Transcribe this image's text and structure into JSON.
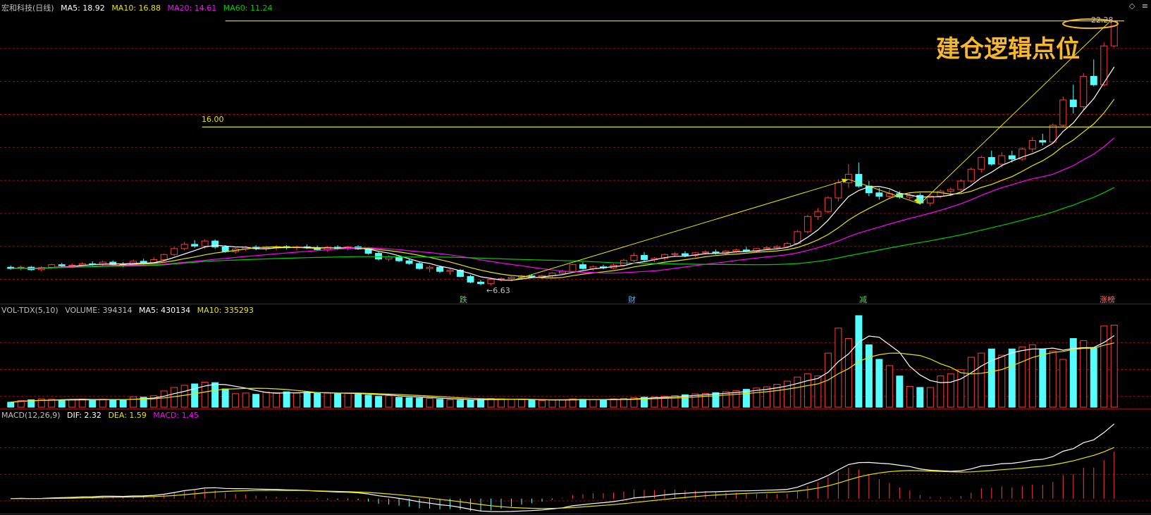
{
  "header": {
    "stock_name": "宏和科技(日线)",
    "ma5": "MA5: 18.92",
    "ma10": "MA10: 16.88",
    "ma20": "MA20: 14.61",
    "ma60": "MA60: 11.24"
  },
  "vol_header": {
    "name": "VOL-TDX(5,10)",
    "volume": "VOLUME: 394314",
    "ma5": "MA5: 430134",
    "ma10": "MA10: 335293"
  },
  "macd_header": {
    "name": "MACD(12,26,9)",
    "dif": "DIF: 2.32",
    "dea": "DEA: 1.59",
    "macd": "MACD: 1.45"
  },
  "icons": {
    "diamond": "◇",
    "menu": "≡"
  },
  "annotations": {
    "big_text": "建仓逻辑点位",
    "level_16": "16.00",
    "high_label": "22.28",
    "low_label": "←6.63",
    "event_1": "跌",
    "event_2": "财",
    "event_3": "减",
    "event_4": "涨榜"
  },
  "colors": {
    "up": "#ff3b3b",
    "down": "#54fcfc",
    "ma5": "#ffffff",
    "ma10": "#e6e600",
    "ma20": "#ff00ff",
    "ma60": "#00cc00",
    "grid": "#8a1010",
    "hline": "#e6e600",
    "annot": "#f3b82e"
  },
  "chart_data": [
    {
      "type": "candlestick",
      "series_hint": "daily candles, price in CNY",
      "ylim": [
        6,
        22.6
      ],
      "ohlc": [
        [
          7.7,
          7.8,
          7.55,
          7.62
        ],
        [
          7.62,
          7.8,
          7.5,
          7.7
        ],
        [
          7.7,
          7.78,
          7.48,
          7.55
        ],
        [
          7.55,
          7.75,
          7.45,
          7.68
        ],
        [
          7.68,
          7.9,
          7.6,
          7.85
        ],
        [
          7.85,
          7.95,
          7.7,
          7.78
        ],
        [
          7.78,
          7.92,
          7.65,
          7.82
        ],
        [
          7.82,
          8.0,
          7.72,
          7.9
        ],
        [
          7.9,
          8.05,
          7.8,
          7.88
        ],
        [
          7.88,
          8.1,
          7.75,
          8.0
        ],
        [
          8.0,
          8.1,
          7.8,
          7.86
        ],
        [
          7.86,
          8.0,
          7.7,
          7.82
        ],
        [
          7.82,
          8.15,
          7.76,
          8.05
        ],
        [
          8.05,
          8.2,
          7.85,
          7.95
        ],
        [
          7.95,
          8.3,
          7.9,
          8.15
        ],
        [
          8.15,
          8.5,
          8.05,
          8.45
        ],
        [
          8.45,
          8.9,
          8.35,
          8.8
        ],
        [
          8.8,
          9.2,
          8.7,
          9.05
        ],
        [
          9.05,
          9.3,
          8.85,
          8.95
        ],
        [
          8.95,
          9.35,
          8.8,
          9.25
        ],
        [
          9.25,
          9.35,
          8.8,
          8.9
        ],
        [
          8.9,
          9.0,
          8.55,
          8.62
        ],
        [
          8.62,
          8.85,
          8.5,
          8.78
        ],
        [
          8.78,
          8.95,
          8.65,
          8.88
        ],
        [
          8.88,
          9.0,
          8.7,
          8.8
        ],
        [
          8.8,
          8.95,
          8.65,
          8.85
        ],
        [
          8.85,
          9.0,
          8.7,
          8.92
        ],
        [
          8.92,
          9.0,
          8.75,
          8.85
        ],
        [
          8.85,
          8.98,
          8.7,
          8.9
        ],
        [
          8.9,
          9.05,
          8.78,
          8.86
        ],
        [
          8.86,
          8.98,
          8.68,
          8.74
        ],
        [
          8.74,
          8.95,
          8.62,
          8.88
        ],
        [
          8.88,
          9.0,
          8.72,
          8.8
        ],
        [
          8.8,
          8.95,
          8.7,
          8.9
        ],
        [
          8.9,
          9.0,
          8.72,
          8.78
        ],
        [
          8.78,
          8.88,
          8.45,
          8.52
        ],
        [
          8.52,
          8.6,
          8.1,
          8.18
        ],
        [
          8.18,
          8.4,
          8.05,
          8.3
        ],
        [
          8.3,
          8.35,
          8.0,
          8.08
        ],
        [
          8.08,
          8.2,
          7.85,
          7.92
        ],
        [
          7.92,
          8.05,
          7.55,
          7.62
        ],
        [
          7.62,
          7.8,
          7.4,
          7.7
        ],
        [
          7.7,
          7.78,
          7.35,
          7.45
        ],
        [
          7.45,
          7.6,
          7.25,
          7.52
        ],
        [
          7.52,
          7.6,
          7.1,
          7.15
        ],
        [
          7.15,
          7.25,
          6.75,
          6.82
        ],
        [
          6.82,
          6.95,
          6.63,
          6.72
        ],
        [
          6.72,
          7.05,
          6.63,
          6.98
        ],
        [
          6.98,
          7.1,
          6.85,
          7.02
        ],
        [
          7.02,
          7.15,
          6.92,
          7.1
        ],
        [
          7.1,
          7.25,
          7.0,
          7.18
        ],
        [
          7.18,
          7.3,
          7.05,
          7.12
        ],
        [
          7.12,
          7.25,
          7.0,
          7.2
        ],
        [
          7.2,
          7.4,
          7.1,
          7.35
        ],
        [
          7.35,
          7.55,
          7.25,
          7.45
        ],
        [
          7.45,
          7.9,
          7.4,
          7.85
        ],
        [
          7.85,
          8.0,
          7.55,
          7.62
        ],
        [
          7.62,
          7.8,
          7.5,
          7.72
        ],
        [
          7.72,
          7.85,
          7.58,
          7.66
        ],
        [
          7.66,
          7.9,
          7.6,
          7.82
        ],
        [
          7.82,
          8.2,
          7.75,
          8.1
        ],
        [
          8.1,
          8.55,
          8.0,
          8.4
        ],
        [
          8.4,
          8.6,
          8.05,
          8.15
        ],
        [
          8.15,
          8.3,
          8.0,
          8.22
        ],
        [
          8.22,
          8.5,
          8.1,
          8.45
        ],
        [
          8.45,
          8.6,
          8.3,
          8.5
        ],
        [
          8.5,
          8.65,
          8.3,
          8.4
        ],
        [
          8.4,
          8.6,
          8.3,
          8.55
        ],
        [
          8.55,
          8.7,
          8.45,
          8.6
        ],
        [
          8.6,
          8.75,
          8.45,
          8.52
        ],
        [
          8.52,
          8.7,
          8.4,
          8.65
        ],
        [
          8.65,
          8.8,
          8.55,
          8.72
        ],
        [
          8.72,
          8.9,
          8.6,
          8.65
        ],
        [
          8.65,
          8.85,
          8.55,
          8.8
        ],
        [
          8.8,
          8.95,
          8.7,
          8.85
        ],
        [
          8.85,
          9.0,
          8.75,
          8.92
        ],
        [
          8.92,
          9.2,
          8.85,
          9.1
        ],
        [
          9.1,
          9.9,
          9.05,
          9.8
        ],
        [
          9.8,
          10.8,
          9.7,
          10.7
        ],
        [
          10.7,
          11.2,
          10.5,
          11.0
        ],
        [
          11.0,
          11.9,
          10.9,
          11.8
        ],
        [
          11.8,
          12.9,
          11.6,
          12.7
        ],
        [
          12.7,
          13.8,
          12.4,
          13.2
        ],
        [
          13.2,
          13.9,
          12.4,
          12.5
        ],
        [
          12.5,
          12.8,
          11.9,
          12.1
        ],
        [
          12.1,
          12.4,
          11.7,
          11.9
        ],
        [
          11.9,
          12.3,
          11.8,
          12.05
        ],
        [
          12.05,
          12.2,
          11.75,
          11.85
        ],
        [
          11.85,
          12.1,
          11.7,
          11.95
        ],
        [
          11.95,
          12.1,
          11.4,
          11.5
        ],
        [
          11.5,
          12.0,
          11.3,
          11.9
        ],
        [
          11.9,
          12.3,
          11.8,
          12.2
        ],
        [
          12.2,
          12.4,
          11.9,
          12.3
        ],
        [
          12.3,
          12.9,
          12.2,
          12.8
        ],
        [
          12.8,
          13.6,
          12.7,
          13.5
        ],
        [
          13.5,
          14.3,
          13.3,
          14.2
        ],
        [
          14.2,
          14.6,
          13.7,
          13.8
        ],
        [
          13.8,
          14.5,
          13.6,
          14.3
        ],
        [
          14.3,
          14.6,
          13.9,
          14.1
        ],
        [
          14.1,
          14.8,
          14.0,
          14.7
        ],
        [
          14.7,
          15.4,
          14.5,
          15.2
        ],
        [
          15.2,
          15.6,
          14.9,
          15.1
        ],
        [
          15.1,
          16.2,
          15.0,
          16.1
        ],
        [
          16.1,
          17.8,
          16.0,
          17.6
        ],
        [
          17.6,
          18.5,
          16.8,
          17.2
        ],
        [
          17.2,
          19.2,
          17.0,
          19.0
        ],
        [
          19.0,
          20.0,
          18.4,
          18.5
        ],
        [
          18.5,
          21.0,
          18.4,
          20.8
        ],
        [
          20.8,
          22.28,
          20.7,
          22.28
        ]
      ],
      "hline_value": 16.0,
      "high_value": 22.28,
      "low_value": 6.63
    },
    {
      "type": "bar",
      "series_hint": "daily volume",
      "ylim": [
        0,
        440000
      ],
      "values": [
        24000,
        32000,
        36000,
        40000,
        38000,
        35000,
        37000,
        39000,
        36000,
        38000,
        34000,
        33000,
        50000,
        48000,
        55000,
        78000,
        95000,
        105000,
        112000,
        120000,
        118000,
        88000,
        65000,
        68000,
        62000,
        72000,
        70000,
        74000,
        68000,
        72000,
        66000,
        68000,
        64000,
        66000,
        62000,
        58000,
        52000,
        55000,
        48000,
        46000,
        44000,
        42000,
        38000,
        36000,
        34000,
        33000,
        38000,
        42000,
        40000,
        38000,
        36000,
        34000,
        32000,
        34000,
        36000,
        40000,
        38000,
        36000,
        34000,
        40000,
        42000,
        45000,
        48000,
        50000,
        52000,
        56000,
        60000,
        64000,
        66000,
        70000,
        74000,
        80000,
        86000,
        92000,
        98000,
        110000,
        125000,
        145000,
        160000,
        150000,
        260000,
        380000,
        330000,
        440000,
        300000,
        230000,
        200000,
        150000,
        100000,
        95000,
        95000,
        150000,
        160000,
        180000,
        240000,
        260000,
        280000,
        250000,
        280000,
        290000,
        300000,
        280000,
        270000,
        230000,
        330000,
        320000,
        285000,
        390000,
        394314
      ]
    },
    {
      "type": "line",
      "series_hint": "MACD DIF/DEA and histogram",
      "ylim": [
        -0.4,
        2.4
      ],
      "dif_last": 2.32,
      "dea_last": 1.59,
      "macd_last": 1.45
    }
  ]
}
